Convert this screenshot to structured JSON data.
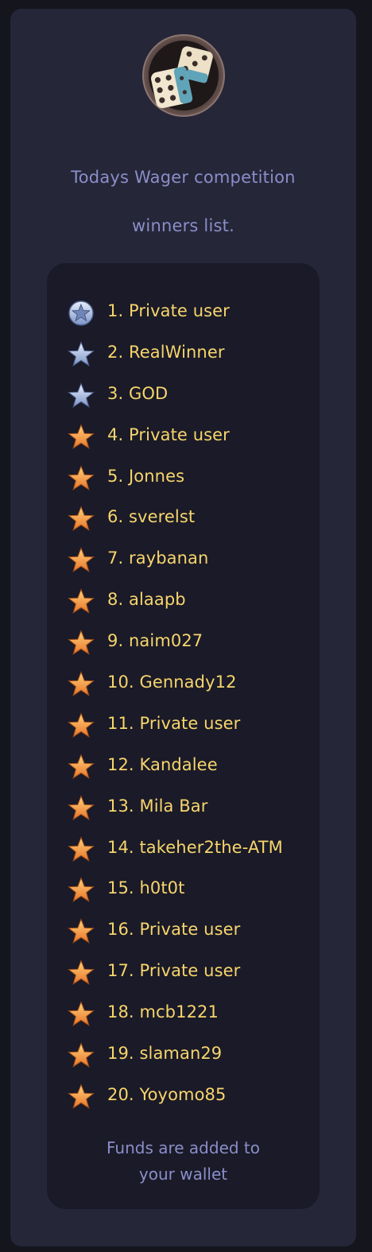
{
  "header": {
    "title_line1": "Todays Wager competition",
    "title_line2": "winners list."
  },
  "winners": [
    {
      "rank_label": "1. Private user",
      "badge": "star-medal-icon"
    },
    {
      "rank_label": "2. RealWinner",
      "badge": "silver-star-icon"
    },
    {
      "rank_label": "3. GOD",
      "badge": "silver-star-icon"
    },
    {
      "rank_label": "4. Private user",
      "badge": "gold-star-icon"
    },
    {
      "rank_label": "5. Jonnes",
      "badge": "gold-star-icon"
    },
    {
      "rank_label": "6. sverelst",
      "badge": "gold-star-icon"
    },
    {
      "rank_label": "7. raybanan",
      "badge": "gold-star-icon"
    },
    {
      "rank_label": "8. alaapb",
      "badge": "gold-star-icon"
    },
    {
      "rank_label": "9. naim027",
      "badge": "gold-star-icon"
    },
    {
      "rank_label": "10. Gennady12",
      "badge": "gold-star-icon"
    },
    {
      "rank_label": "11. Private user",
      "badge": "gold-star-icon"
    },
    {
      "rank_label": "12. Kandalee",
      "badge": "gold-star-icon"
    },
    {
      "rank_label": "13. Mila Bar",
      "badge": "gold-star-icon"
    },
    {
      "rank_label": "14. takeher2the-ATM",
      "badge": "gold-star-icon"
    },
    {
      "rank_label": "15. h0t0t",
      "badge": "gold-star-icon"
    },
    {
      "rank_label": "16. Private user",
      "badge": "gold-star-icon"
    },
    {
      "rank_label": "17. Private user",
      "badge": "gold-star-icon"
    },
    {
      "rank_label": "18. mcb1221",
      "badge": "gold-star-icon"
    },
    {
      "rank_label": "19. slaman29",
      "badge": "gold-star-icon"
    },
    {
      "rank_label": "20. Yoyomo85",
      "badge": "gold-star-icon"
    }
  ],
  "footer": {
    "line1": "Funds are added to",
    "line2": "your wallet"
  },
  "colors": {
    "page_bg": "#14151d",
    "card_bg": "#252638",
    "inner_bg": "#1a1a28",
    "title_text": "#8a8ec8",
    "name_text": "#f7d56c"
  }
}
